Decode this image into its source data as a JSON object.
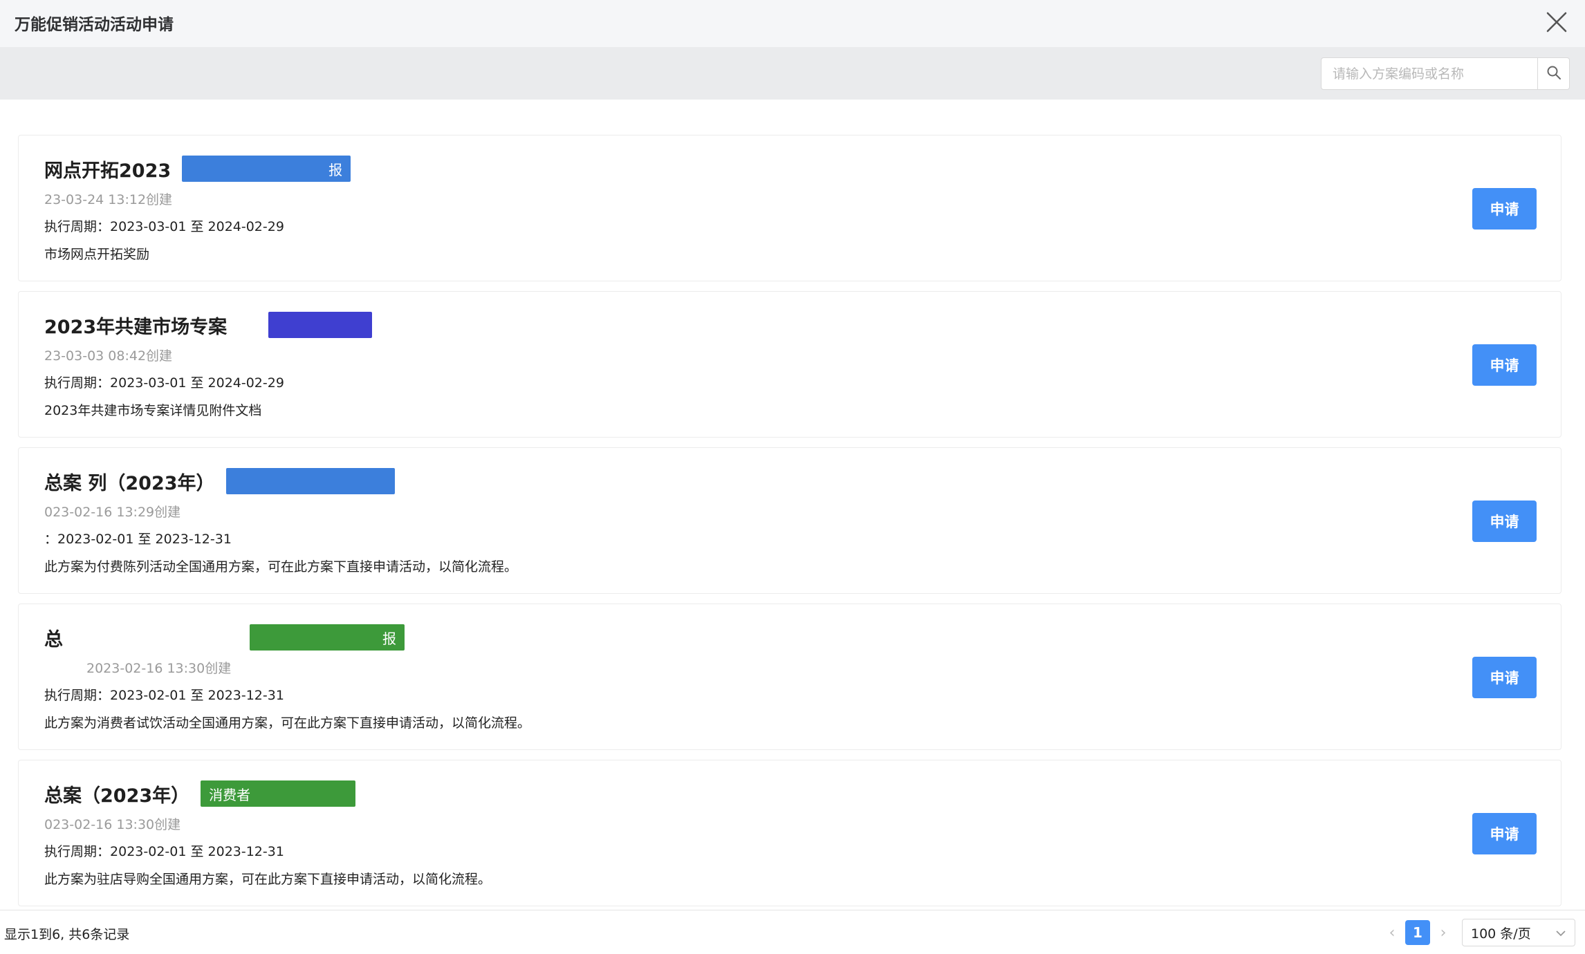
{
  "window": {
    "title": "万能促销活动活动申请"
  },
  "search": {
    "placeholder": "请输入方案编码或名称",
    "value": ""
  },
  "plans": [
    {
      "title": "网点开拓2023",
      "tag": "报",
      "tag_color": "#3c7fdc",
      "created": "23-03-24 13:12创建",
      "period_label": "执行周期：",
      "period": "2023-03-01 至 2024-02-29",
      "description": "市场网点开拓奖励",
      "apply_label": "申请"
    },
    {
      "title": "2023年共建市场专案",
      "tag": "",
      "tag_color": "#3f3fd0",
      "created": "23-03-03 08:42创建",
      "period_label": "执行周期：",
      "period": "2023-03-01 至 2024-02-29",
      "description": "2023年共建市场专案详情见附件文档",
      "apply_label": "申请"
    },
    {
      "title": "总案 列（2023年）",
      "tag": "",
      "tag_color": "#3c7fdc",
      "created": "023-02-16 13:29创建",
      "period_label": "：",
      "period": "2023-02-01 至 2023-12-31",
      "description": "此方案为付费陈列活动全国通用方案，可在此方案下直接申请活动，以简化流程。",
      "apply_label": "申请"
    },
    {
      "title": "总",
      "tag": "报",
      "tag_color": "#3d9a3a",
      "created": "2023-02-16 13:30创建",
      "period_label": "执行周期：",
      "period": "2023-02-01 至 2023-12-31",
      "description": "此方案为消费者试饮活动全国通用方案，可在此方案下直接申请活动，以简化流程。",
      "apply_label": "申请"
    },
    {
      "title": "总案（2023年）",
      "tag": "消费者",
      "tag_color": "#3d9a3a",
      "created": "023-02-16 13:30创建",
      "period_label": "执行周期：",
      "period": "2023-02-01 至 2023-12-31",
      "description": "此方案为驻店导购全国通用方案，可在此方案下直接申请活动，以简化流程。",
      "apply_label": "申请"
    }
  ],
  "footer": {
    "info": "显示1到6, 共6条记录",
    "current_page": "1",
    "page_size": "100 条/页"
  }
}
